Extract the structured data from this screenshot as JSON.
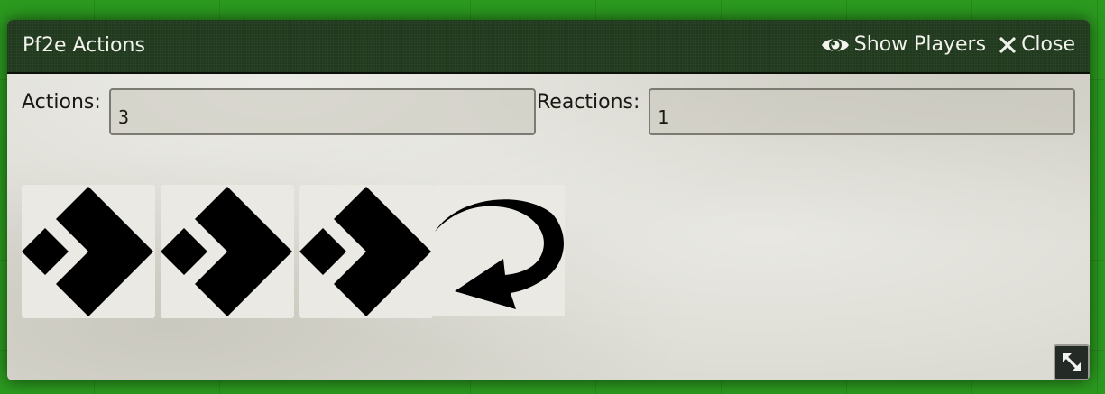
{
  "window": {
    "title": "Pf2e Actions",
    "show_players_label": "Show Players",
    "close_label": "Close"
  },
  "fields": {
    "actions": {
      "label": "Actions:",
      "value": "3"
    },
    "reactions": {
      "label": "Reactions:",
      "value": "1"
    }
  },
  "tiles": [
    {
      "icon": "single-action-icon"
    },
    {
      "icon": "single-action-icon"
    },
    {
      "icon": "single-action-icon"
    },
    {
      "icon": "reaction-icon"
    }
  ],
  "icons": {
    "show_players": "eye-icon",
    "close": "close-icon",
    "resize": "resize-icon"
  },
  "colors": {
    "header_bg": "#213a1e",
    "canvas_bg": "#2b9a1f",
    "window_bg": "#dcdbd3"
  }
}
